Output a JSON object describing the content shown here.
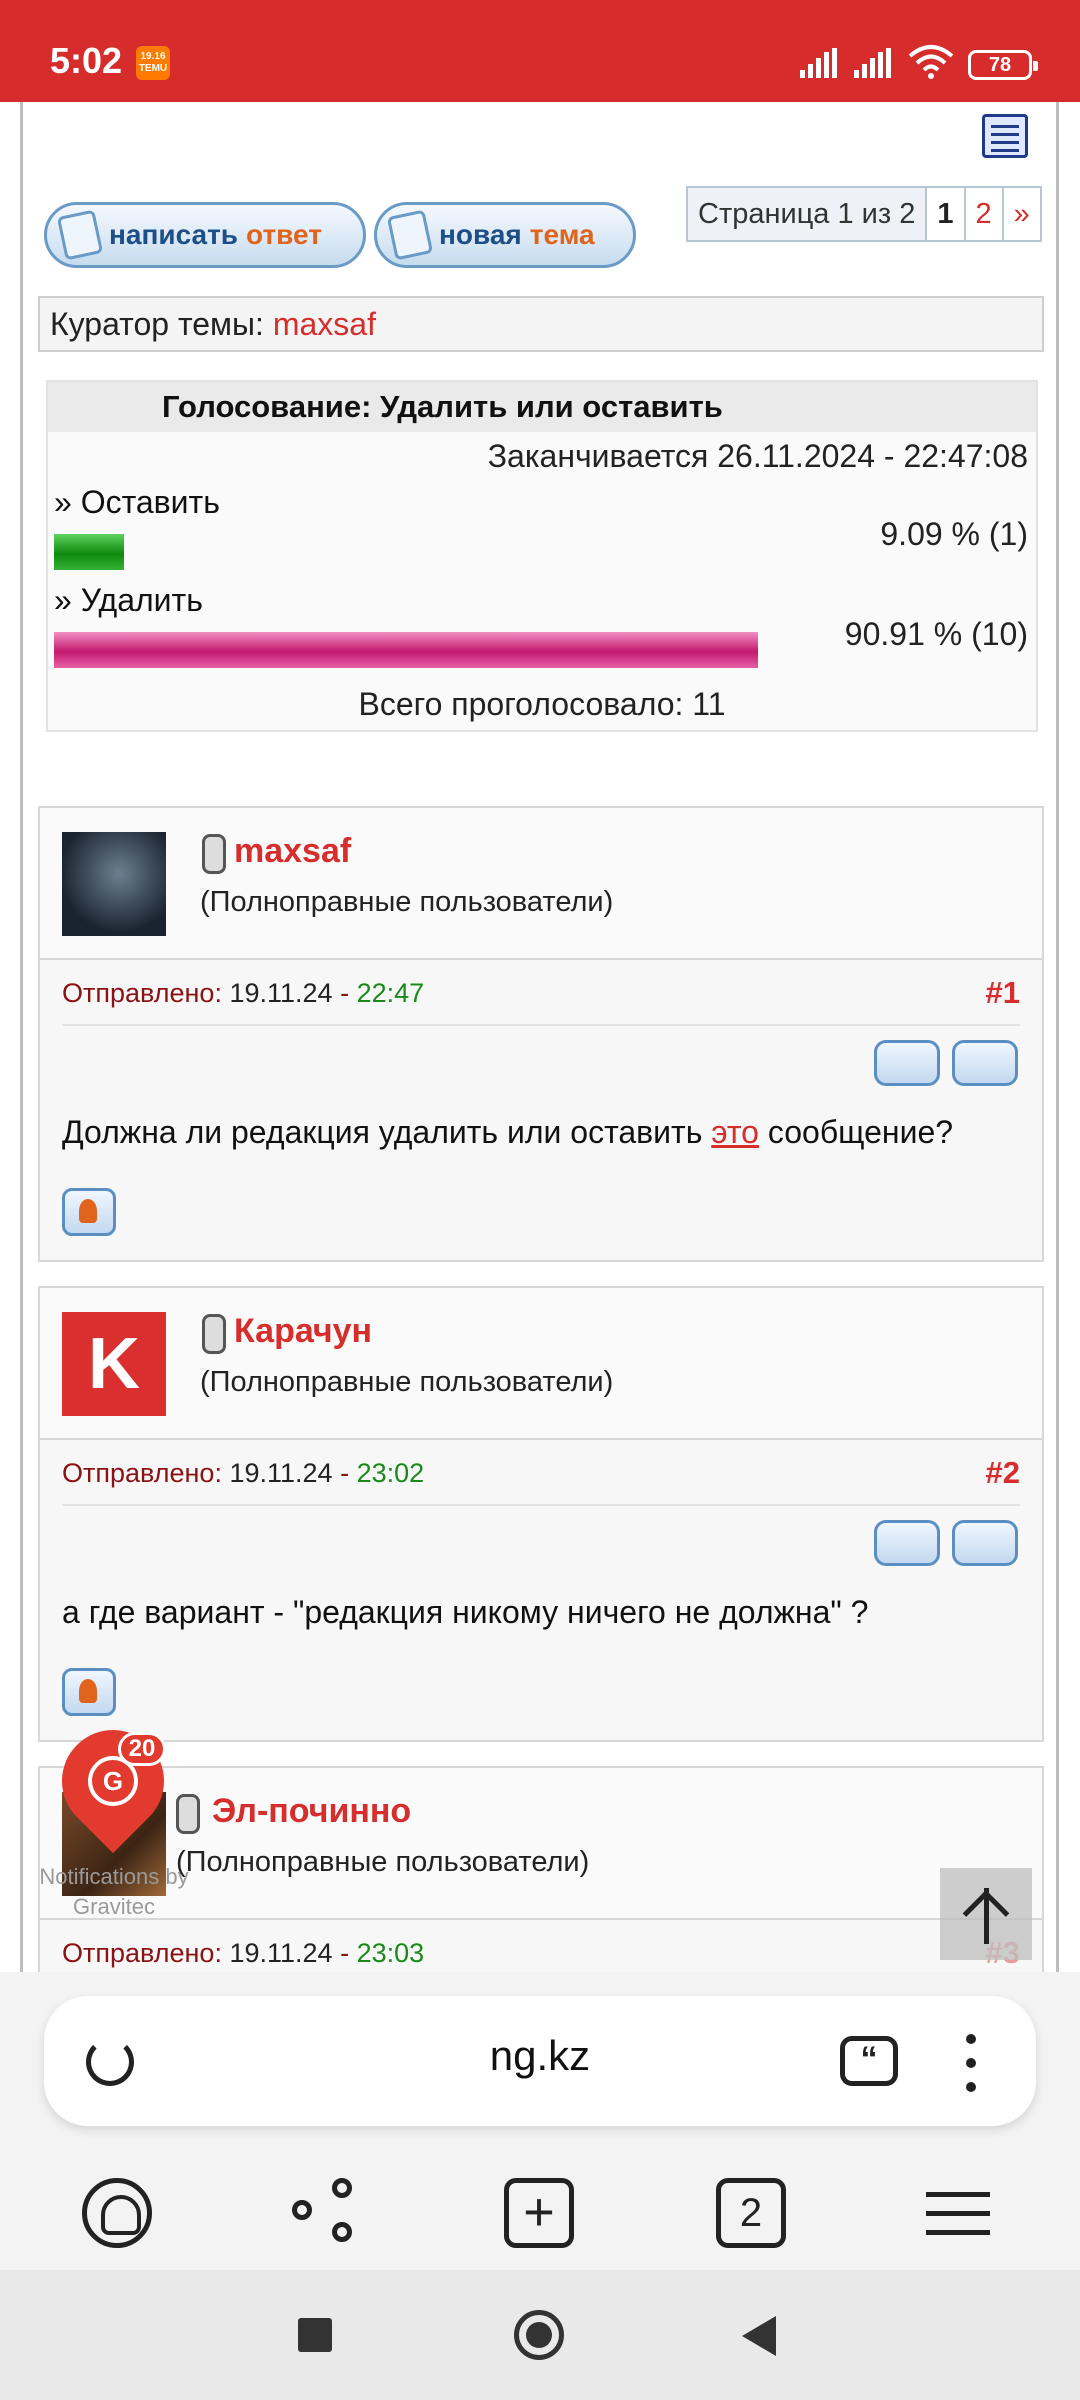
{
  "status_bar": {
    "time": "5:02",
    "temu_badge": "TEMU",
    "battery": "78"
  },
  "forum": {
    "reply_button": {
      "main": "написать",
      "accent": "ответ"
    },
    "new_topic_button": {
      "main": "новая",
      "accent": "тема"
    },
    "pagination": {
      "label": "Страница 1 из 2",
      "current": "1",
      "next_page": "2",
      "next_arrow": "»"
    },
    "curator": {
      "label": "Куратор темы:",
      "user": "maxsaf"
    },
    "poll": {
      "title": "Голосование: Удалить или оставить",
      "ends": "Заканчивается 26.11.2024 - 22:47:08",
      "options": [
        {
          "label": "» Оставить",
          "result": "9.09 % (1)",
          "percent": 9.09
        },
        {
          "label": "» Удалить",
          "result": "90.91 % (10)",
          "percent": 90.91
        }
      ],
      "total": "Всего проголосовало: 11"
    },
    "posts": [
      {
        "nick": "maxsaf",
        "role": "(Полноправные пользователи)",
        "sent_label": "Отправлено:",
        "date": "19.11.24",
        "sep": "-",
        "time": "22:47",
        "number": "#1",
        "body_before": "Должна ли редакция удалить или оставить",
        "body_link": "это",
        "body_after": "сообщение?"
      },
      {
        "nick": "Карачун",
        "avatar_letter": "K",
        "role": "(Полноправные пользователи)",
        "sent_label": "Отправлено:",
        "date": "19.11.24",
        "sep": "-",
        "time": "23:02",
        "number": "#2",
        "body": "а где вариант - \"редакция никому ничего не должна\" ?"
      },
      {
        "nick": "Эл-починно",
        "role": "(Полноправные пользователи)",
        "sent_label": "Отправлено:",
        "date": "19.11.24",
        "sep": "-",
        "time": "23:03",
        "number": "#3"
      }
    ]
  },
  "gravitec": {
    "badge": "20",
    "text_line1": "Notifications by",
    "text_line2": "Gravitec"
  },
  "browser": {
    "url": "ng.kz",
    "tabs_count": "2"
  }
}
